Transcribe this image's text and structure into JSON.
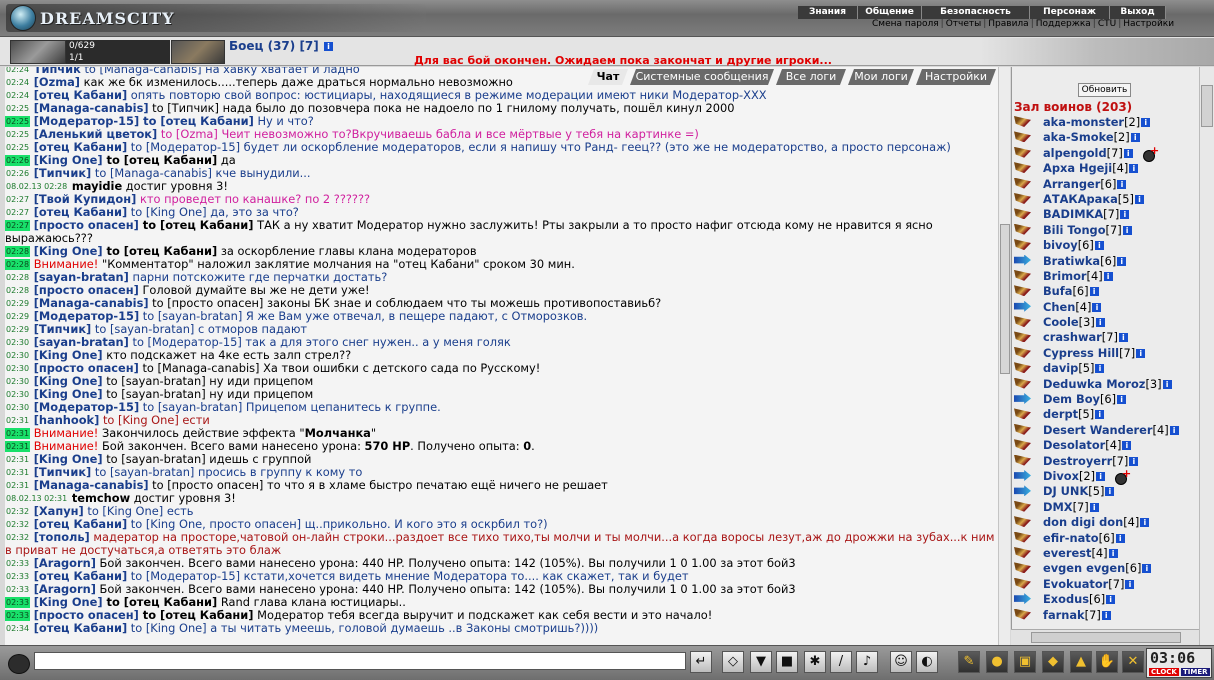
{
  "header": {
    "logo": "DREAMSCITY",
    "menu_top": [
      "Знания",
      "Общение",
      "Безопасность",
      "Персонаж",
      "Выход"
    ],
    "menu_sub": [
      "Смена пароля",
      "Отчеты",
      "Правила",
      "Поддержка",
      "CTU",
      "Настройки"
    ],
    "separator": "|"
  },
  "character": {
    "name": "Боец (37) [7]",
    "hp": "0/629",
    "mp": "1/1",
    "hp_fraction": 0.0,
    "battle_message": "Для вас бой окончен. Ожидаем пока закончат и другие игроки..."
  },
  "tabs": [
    "Чат",
    "Системные сообщения",
    "Все логи",
    "Мои логи",
    "Настройки"
  ],
  "active_tab": "Чат",
  "chat": {
    "lines": [
      {
        "t": "02:24",
        "hl": false,
        "parts": [
          [
            "nk",
            "Типчик"
          ],
          [
            "bl",
            " to [Managa-canabis] на хавку хватает и ладно"
          ]
        ]
      },
      {
        "t": "02:24",
        "hl": false,
        "parts": [
          [
            "nk",
            "[Ozma]"
          ],
          [
            "",
            " как же бк изменилось.....теперь даже драться нормально невозможно"
          ]
        ]
      },
      {
        "t": "02:24",
        "hl": false,
        "parts": [
          [
            "nk",
            "[отец Кабани]"
          ],
          [
            "bl",
            " опять повторю свой вопрос: юстициары, находящиеся в режиме модерации имеют ники Модератор-XXX"
          ]
        ]
      },
      {
        "t": "02:25",
        "hl": false,
        "parts": [
          [
            "nk",
            "[Managa-canabis]"
          ],
          [
            "",
            " to [Типчик] нада было до позовчера пока не надоело по 1 гнилому получать, пошёл кинул 2000"
          ]
        ]
      },
      {
        "t": "02:25",
        "hl": true,
        "parts": [
          [
            "nk",
            "[Модератор-15]"
          ],
          [
            "nk",
            " to [отец Кабани]"
          ],
          [
            "bl",
            " Ну и что?"
          ]
        ]
      },
      {
        "t": "02:25",
        "hl": false,
        "parts": [
          [
            "nk",
            "[Аленький цветок]"
          ],
          [
            "pk",
            " to [Ozma] Чеит невозможно то?Вкручиваешь бабла и все мёртвые у тебя на картинке =)"
          ]
        ]
      },
      {
        "t": "02:25",
        "hl": false,
        "parts": [
          [
            "nk",
            "[отец Кабани]"
          ],
          [
            "bl",
            " to [Модератор-15] будет ли оскорбление модераторов, если я напишу что Ранд- геец?? (это же не модераторство, а просто персонаж)"
          ]
        ]
      },
      {
        "t": "02:26",
        "hl": true,
        "parts": [
          [
            "nk",
            "[King One]"
          ],
          [
            "nkb",
            " to [отец Кабани]"
          ],
          [
            "",
            " да"
          ]
        ]
      },
      {
        "t": "02:26",
        "hl": false,
        "parts": [
          [
            "nk",
            "[Типчик]"
          ],
          [
            "bl",
            " to [Managa-canabis] кче вынудили..."
          ]
        ]
      },
      {
        "t": "08.02.13 02:28",
        "hl": false,
        "parts": [
          [
            "nkb",
            "mayidie"
          ],
          [
            "",
            " достиг уровня 3!"
          ]
        ]
      },
      {
        "t": "02:27",
        "hl": false,
        "parts": [
          [
            "nk",
            "[Твой Купидон]"
          ],
          [
            "pk",
            " кто проведет по канашке? по 2 ??????"
          ]
        ]
      },
      {
        "t": "02:27",
        "hl": false,
        "parts": [
          [
            "nk",
            "[отец Кабани]"
          ],
          [
            "bl",
            " to [King One] да, это за что?"
          ]
        ]
      },
      {
        "t": "02:27",
        "hl": true,
        "wrap": true,
        "parts": [
          [
            "nk",
            "[просто опасен]"
          ],
          [
            "nkb",
            " to [отец Кабани]"
          ],
          [
            "",
            " ТАК а ну хватит Модератор нужно заслужить! Рты закрыли а то просто нафиг отсюда кому не нравится я ясно выражаюсь???"
          ]
        ]
      },
      {
        "t": "02:28",
        "hl": true,
        "parts": [
          [
            "nk",
            "[King One]"
          ],
          [
            "nkb",
            " to [отец Кабани]"
          ],
          [
            "",
            " за оскорбление главы клана модераторов"
          ]
        ]
      },
      {
        "t": "02:28",
        "hl": true,
        "parts": [
          [
            "rd",
            "Внимание!"
          ],
          [
            "",
            " \"Комментатор\" наложил заклятие молчания на \"отец Кабани\" сроком 30 мин."
          ]
        ]
      },
      {
        "t": "02:28",
        "hl": false,
        "parts": [
          [
            "nk",
            "[sayan-bratan]"
          ],
          [
            "bl",
            " парни потскожите где перчатки достать?"
          ]
        ]
      },
      {
        "t": "02:28",
        "hl": false,
        "parts": [
          [
            "nk",
            "[просто опасен]"
          ],
          [
            "",
            " Головой думайте вы же не дети уже!"
          ]
        ]
      },
      {
        "t": "02:29",
        "hl": false,
        "parts": [
          [
            "nk",
            "[Managa-canabis]"
          ],
          [
            "",
            " to [просто опасен] законы БК знае и соблюдаем что ты можешь противопоставиьб?"
          ]
        ]
      },
      {
        "t": "02:29",
        "hl": false,
        "parts": [
          [
            "nk",
            "[Модератор-15]"
          ],
          [
            "bl",
            " to [sayan-bratan] Я же Вам уже отвечал, в пещере падают, с Отморозков."
          ]
        ]
      },
      {
        "t": "02:29",
        "hl": false,
        "parts": [
          [
            "nk",
            "[Типчик]"
          ],
          [
            "bl",
            " to [sayan-bratan] с отморов падают"
          ]
        ]
      },
      {
        "t": "02:30",
        "hl": false,
        "parts": [
          [
            "nk",
            "[sayan-bratan]"
          ],
          [
            "bl",
            " to [Модератор-15] так а для этого снег нужен.. а у меня голяк"
          ]
        ]
      },
      {
        "t": "02:30",
        "hl": false,
        "parts": [
          [
            "nk",
            "[King One]"
          ],
          [
            "",
            " кто подскажет на 4ке есть залп стрел??"
          ]
        ]
      },
      {
        "t": "02:30",
        "hl": false,
        "parts": [
          [
            "nk",
            "[просто опасен]"
          ],
          [
            "",
            " to [Managa-canabis] Ха твои ошибки с детского сада по Русскому!"
          ]
        ]
      },
      {
        "t": "02:30",
        "hl": false,
        "parts": [
          [
            "nk",
            "[King One]"
          ],
          [
            "",
            " to [sayan-bratan] ну иди прицепом"
          ]
        ]
      },
      {
        "t": "02:30",
        "hl": false,
        "parts": [
          [
            "nk",
            "[King One]"
          ],
          [
            "",
            " to [sayan-bratan] ну иди прицепом"
          ]
        ]
      },
      {
        "t": "02:30",
        "hl": false,
        "parts": [
          [
            "nk",
            "[Модератор-15]"
          ],
          [
            "bl",
            " to [sayan-bratan] Прицепом цепанитесь к группе."
          ]
        ]
      },
      {
        "t": "02:31",
        "hl": false,
        "parts": [
          [
            "nk",
            "[hanhook]"
          ],
          [
            "dr",
            " to [King One] ести"
          ]
        ]
      },
      {
        "t": "02:31",
        "hl": true,
        "parts": [
          [
            "rd",
            "Внимание!"
          ],
          [
            "",
            " Закончилось действие эффекта \""
          ],
          [
            "b",
            "Молчанка"
          ],
          [
            "",
            "\""
          ]
        ]
      },
      {
        "t": "02:31",
        "hl": true,
        "parts": [
          [
            "rd",
            "Внимание!"
          ],
          [
            "",
            " Бой закончен. Всего вами нанесено урона: "
          ],
          [
            "b",
            "570 HP"
          ],
          [
            "",
            ". Получено опыта: "
          ],
          [
            "b",
            "0"
          ],
          [
            "",
            "."
          ]
        ]
      },
      {
        "t": "02:31",
        "hl": false,
        "parts": [
          [
            "nk",
            "[King One]"
          ],
          [
            "",
            " to [sayan-bratan] идешь с группой"
          ]
        ]
      },
      {
        "t": "02:31",
        "hl": false,
        "parts": [
          [
            "nk",
            "[Типчик]"
          ],
          [
            "bl",
            " to [sayan-bratan] просись в группу к кому то"
          ]
        ]
      },
      {
        "t": "02:31",
        "hl": false,
        "parts": [
          [
            "nk",
            "[Managa-canabis]"
          ],
          [
            "",
            " to [просто опасен] то что я в хламе быстро печатаю ещё ничего не решает"
          ]
        ]
      },
      {
        "t": "08.02.13 02:31",
        "hl": false,
        "parts": [
          [
            "nkb",
            "temchow"
          ],
          [
            "",
            " достиг уровня 3!"
          ]
        ]
      },
      {
        "t": "02:32",
        "hl": false,
        "parts": [
          [
            "nk",
            "[Хапун]"
          ],
          [
            "bl",
            " to [King One] есть"
          ]
        ]
      },
      {
        "t": "02:32",
        "hl": false,
        "parts": [
          [
            "nk",
            "[отец Кабани]"
          ],
          [
            "bl",
            " to [King One, просто опасен] щ..прикольно. И кого это я оскрбил то?)"
          ]
        ]
      },
      {
        "t": "02:32",
        "hl": false,
        "wrap": true,
        "parts": [
          [
            "nk",
            "[тополь]"
          ],
          [
            "dr",
            " мадератор на просторе,чатовой он-лайн строки...раздоет все тихо тихо,ты молчи и ты молчи...а когда воросы лезут,аж до дрожжи на зубах...к ним в приват не достучаться,а ответять это блаж"
          ]
        ]
      },
      {
        "t": "02:33",
        "hl": false,
        "parts": [
          [
            "nk",
            "[Aragorn]"
          ],
          [
            "",
            " Бой закончен. Всего вами нанесено урона: 440 HP. Получено опыта: 142 (105%). Вы получили 1 0 1.00 за этот бой3"
          ]
        ]
      },
      {
        "t": "02:33",
        "hl": false,
        "parts": [
          [
            "nk",
            "[отец Кабани]"
          ],
          [
            "bl",
            " to [Модератор-15] кстати,хочется видеть мнение Модератора то.... как скажет, так и будет"
          ]
        ]
      },
      {
        "t": "02:33",
        "hl": false,
        "parts": [
          [
            "nk",
            "[Aragorn]"
          ],
          [
            "",
            " Бой закончен. Всего вами нанесено урона: 440 HP. Получено опыта: 142 (105%). Вы получили 1 0 1.00 за этот бой3"
          ]
        ]
      },
      {
        "t": "02:33",
        "hl": true,
        "parts": [
          [
            "nk",
            "[King One]"
          ],
          [
            "nkb",
            " to [отец Кабани]"
          ],
          [
            "",
            " Rand глава клана юстициары.."
          ]
        ]
      },
      {
        "t": "02:33",
        "hl": true,
        "parts": [
          [
            "nk",
            "[просто опасен]"
          ],
          [
            "nkb",
            " to [отец Кабани]"
          ],
          [
            "",
            " Модератор тебя всегда выручит и подскажет как себя вести и это начало!"
          ]
        ]
      },
      {
        "t": "02:34",
        "hl": false,
        "parts": [
          [
            "nk",
            "[отец Кабани]"
          ],
          [
            "bl",
            " to [King One] а ты читать умеешь, головой думаешь ..в Законы смотришь?))))"
          ]
        ]
      }
    ]
  },
  "userlist": {
    "refresh_label": "Обновить",
    "title": "Зал воинов (203)",
    "users": [
      {
        "name": "aka-monster",
        "level": "[2]",
        "icon": "A",
        "mark": false
      },
      {
        "name": "aka-Smoke",
        "level": "[2]",
        "icon": "A",
        "mark": false
      },
      {
        "name": "alpengold",
        "level": "[7]",
        "icon": "A",
        "mark": true
      },
      {
        "name": "Арха Нgeji",
        "level": "[4]",
        "icon": "A",
        "mark": false
      },
      {
        "name": "Arranger",
        "level": "[6]",
        "icon": "A",
        "mark": false
      },
      {
        "name": "АТАКАрака",
        "level": "[5]",
        "icon": "A",
        "mark": false
      },
      {
        "name": "BADIMKA",
        "level": "[7]",
        "icon": "A",
        "mark": false
      },
      {
        "name": "Bili Tongo",
        "level": "[7]",
        "icon": "A",
        "mark": false
      },
      {
        "name": "bivoy",
        "level": "[6]",
        "icon": "A",
        "mark": false
      },
      {
        "name": "Bratiwka",
        "level": "[6]",
        "icon": "B",
        "mark": false
      },
      {
        "name": "Brimor",
        "level": "[4]",
        "icon": "A",
        "mark": false
      },
      {
        "name": "Bufa",
        "level": "[6]",
        "icon": "A",
        "mark": false
      },
      {
        "name": "Chen",
        "level": "[4]",
        "icon": "B",
        "mark": false
      },
      {
        "name": "Coole",
        "level": "[3]",
        "icon": "A",
        "mark": false
      },
      {
        "name": "crashwar",
        "level": "[7]",
        "icon": "A",
        "mark": false
      },
      {
        "name": "Cypress Hill",
        "level": "[7]",
        "icon": "A",
        "mark": false
      },
      {
        "name": "davip",
        "level": "[5]",
        "icon": "A",
        "mark": false
      },
      {
        "name": "Deduwka Moroz",
        "level": "[3]",
        "icon": "A",
        "mark": false
      },
      {
        "name": "Dem Boy",
        "level": "[6]",
        "icon": "B",
        "mark": false
      },
      {
        "name": "derpt",
        "level": "[5]",
        "icon": "A",
        "mark": false
      },
      {
        "name": "Desert Wanderer",
        "level": "[4]",
        "icon": "A",
        "mark": false
      },
      {
        "name": "Desolator",
        "level": "[4]",
        "icon": "A",
        "mark": false
      },
      {
        "name": "Destroyerr",
        "level": "[7]",
        "icon": "A",
        "mark": false
      },
      {
        "name": "Divox",
        "level": "[2]",
        "icon": "B",
        "mark": true
      },
      {
        "name": "DJ UNK",
        "level": "[5]",
        "icon": "B",
        "mark": false
      },
      {
        "name": "DMX",
        "level": "[7]",
        "icon": "A",
        "mark": false
      },
      {
        "name": "don digi don",
        "level": "[4]",
        "icon": "A",
        "mark": false
      },
      {
        "name": "efir-nato",
        "level": "[6]",
        "icon": "A",
        "mark": false
      },
      {
        "name": "everest",
        "level": "[4]",
        "icon": "A",
        "mark": false
      },
      {
        "name": "evgen evgen",
        "level": "[6]",
        "icon": "A",
        "mark": false
      },
      {
        "name": "Evokuator",
        "level": "[7]",
        "icon": "A",
        "mark": false
      },
      {
        "name": "Exodus",
        "level": "[6]",
        "icon": "B",
        "mark": false
      },
      {
        "name": "farnak",
        "level": "[7]",
        "icon": "A",
        "mark": false
      }
    ]
  },
  "bottom": {
    "input_value": "",
    "clock": "03:06",
    "clock_label": "CLOCK",
    "timer_label": "TIMER",
    "tools": [
      "enter-icon",
      "eraser-icon",
      "filter-icon",
      "save-icon",
      "walk-icon",
      "slash-icon",
      "music-icon",
      "smile-icon",
      "chat-icon",
      "magic-icon",
      "bag-icon",
      "chest-icon",
      "book-icon",
      "tool-icon",
      "hand-icon",
      "paw-icon",
      "exit-icon"
    ]
  }
}
